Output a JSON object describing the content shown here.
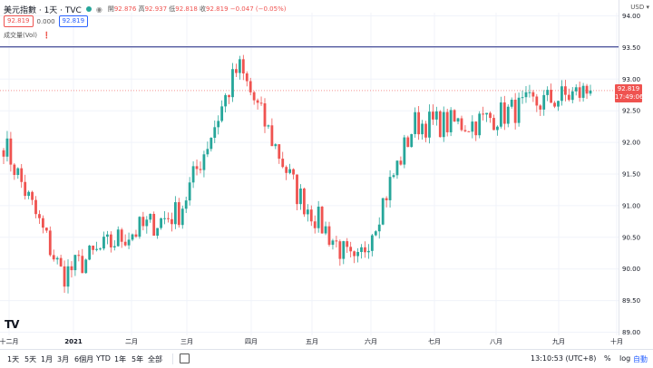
{
  "header": {
    "title": "美元指數 · 1天 · TVC",
    "ohlc_open_label": "開",
    "ohlc_open": "92.876",
    "ohlc_high_label": "高",
    "ohlc_high": "92.937",
    "ohlc_low_label": "低",
    "ohlc_low": "92.818",
    "ohlc_close_label": "收",
    "ohlc_close": "92.819",
    "ohlc_change": "−0.047 (−0.05%)",
    "sell_price": "92.819",
    "spread": "0.000",
    "buy_price": "92.819",
    "volume_label": "成交量(Vol)",
    "currency": "USD"
  },
  "price_tag": {
    "price": "92.819",
    "countdown": "17:49:06"
  },
  "colors": {
    "up": "#26a69a",
    "down": "#ef5350",
    "hline": "#1a237e",
    "grid": "#f0f3fa"
  },
  "toolbar": {
    "ranges": [
      "1天",
      "5天",
      "1月",
      "3月",
      "6個月",
      "YTD",
      "1年",
      "5年",
      "全部"
    ],
    "time": "13:10:53 (UTC+8)",
    "percent": "%",
    "log": "log",
    "auto": "自動"
  },
  "chart_data": {
    "type": "candlestick",
    "symbol": "美元指數",
    "interval": "1天",
    "y_axis": {
      "ticks": [
        94.0,
        93.5,
        93.0,
        92.5,
        92.0,
        91.5,
        91.0,
        90.5,
        90.0,
        89.5,
        89.0
      ],
      "range": [
        88.95,
        94.05
      ]
    },
    "x_axis": {
      "labels": [
        "十二月",
        "2021",
        "二月",
        "三月",
        "四月",
        "五月",
        "六月",
        "七月",
        "八月",
        "九月",
        "十月"
      ]
    },
    "horizontal_line": 93.51,
    "last_price": 92.819,
    "close_path": [
      {
        "label": "十二月",
        "close": 92.0
      },
      {
        "label": "2021",
        "close": 89.9
      },
      {
        "label": "二月",
        "close": 90.5
      },
      {
        "label": "三月",
        "close": 90.9
      },
      {
        "label": "四月",
        "close": 93.2
      },
      {
        "label": "五月",
        "close": 91.2
      },
      {
        "label": "六月",
        "close": 90.0
      },
      {
        "label": "七月",
        "close": 92.3
      },
      {
        "label": "八月",
        "close": 92.3
      },
      {
        "label": "九月",
        "close": 92.6
      },
      {
        "label": "last",
        "close": 92.819
      }
    ]
  }
}
